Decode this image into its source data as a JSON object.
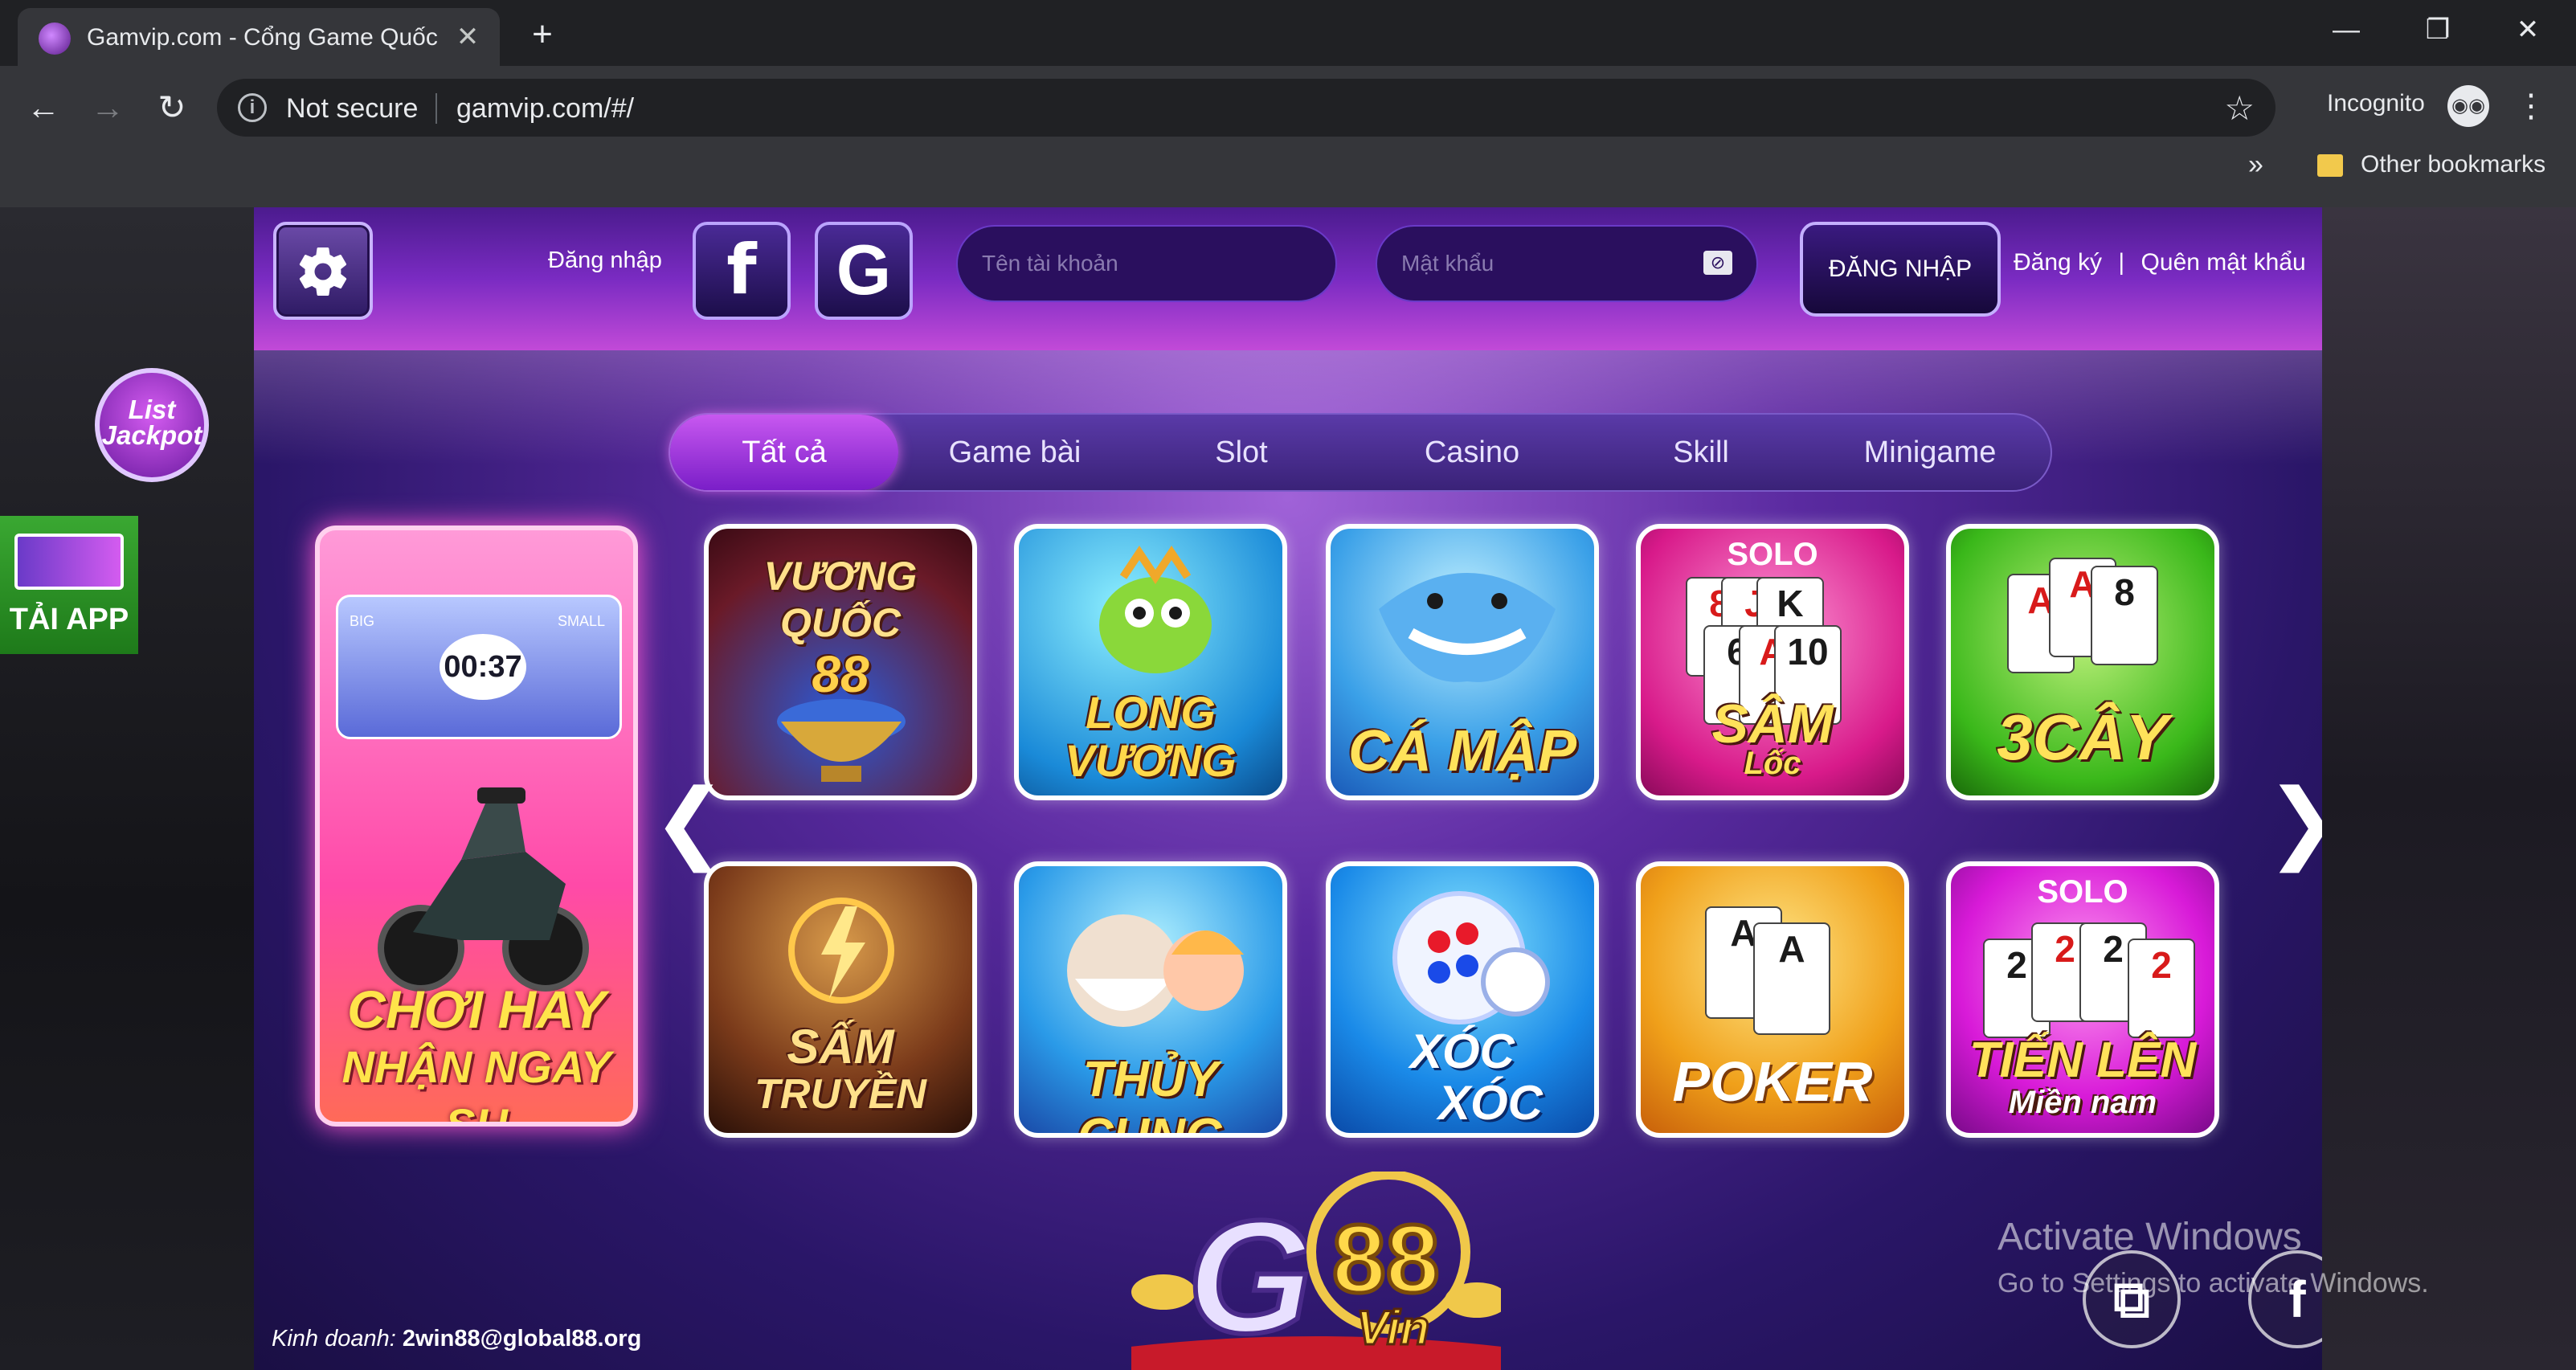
{
  "browser": {
    "tab_title": "Gamvip.com - Cổng Game Quốc",
    "tab_close": "✕",
    "new_tab": "+",
    "win_minimize": "—",
    "win_restore": "❐",
    "win_close": "✕",
    "security_label": "Not secure",
    "url": "gamvip.com/#/",
    "incognito_label": "Incognito",
    "bookmarks_more": "»",
    "other_bookmarks": "Other bookmarks"
  },
  "header": {
    "login_label": "Đăng nhập",
    "facebook_glyph": "f",
    "google_glyph": "G",
    "username_placeholder": "Tên tài khoản",
    "password_placeholder": "Mật khẩu",
    "login_button": "ĐĂNG NHẬP",
    "register_link": "Đăng ký",
    "separator": "|",
    "forgot_link": "Quên mật khẩu"
  },
  "tabs": [
    {
      "label": "Tất cả",
      "active": true
    },
    {
      "label": "Game bài",
      "active": false
    },
    {
      "label": "Slot",
      "active": false
    },
    {
      "label": "Casino",
      "active": false
    },
    {
      "label": "Skill",
      "active": false
    },
    {
      "label": "Minigame",
      "active": false
    }
  ],
  "side": {
    "jackpot_line1": "List",
    "jackpot_line2": "Jackpot",
    "tai_app": "TẢI APP"
  },
  "promo": {
    "timer": "00:37",
    "big_label": "BIG",
    "small_label": "SMALL",
    "line1": "CHƠI HAY",
    "line2": "NHẬN NGAY SH"
  },
  "games": [
    {
      "title": "VƯƠNG QUỐC 88",
      "line1": "VƯƠNG",
      "line2": "QUỐC",
      "line3": "88"
    },
    {
      "title": "LONG VƯƠNG",
      "line1": "LONG",
      "line2": "VƯƠNG"
    },
    {
      "title": "CÁ MẬP",
      "line1": "CÁ MẬP"
    },
    {
      "title": "SÂM LỐC",
      "badge": "SOLO",
      "line1": "SÂM",
      "line2": "Lốc"
    },
    {
      "title": "3 CÂY",
      "line1": "3CÂY"
    },
    {
      "title": "SẤM TRUYỀN",
      "line1": "SẤM",
      "line2": "TRUYỀN"
    },
    {
      "title": "THỦY CUNG",
      "line1": "THỦY CUNG"
    },
    {
      "title": "XÓC XÓC",
      "line1": "XÓC",
      "line2": "XÓC"
    },
    {
      "title": "POKER",
      "line1": "POKER"
    },
    {
      "title": "TIẾN LÊN MIỀN NAM",
      "badge": "SOLO",
      "line1": "TIẾN LÊN",
      "line2": "Miền nam"
    }
  ],
  "nav": {
    "prev": "❮",
    "next": "❯"
  },
  "footer": {
    "logo_g": "G",
    "logo_88": "88",
    "logo_vin": "Vin",
    "contact_label": "Kinh doanh:",
    "contact_email": "2win88@global88.org"
  },
  "watermark": {
    "line1": "Activate Windows",
    "line2": "Go to Settings to activate Windows."
  },
  "colors": {
    "accent": "#7a2bc2",
    "active_tab": "#c858f0",
    "promo_pink": "#ff4aa8",
    "tai_app_green": "#3aa832"
  }
}
